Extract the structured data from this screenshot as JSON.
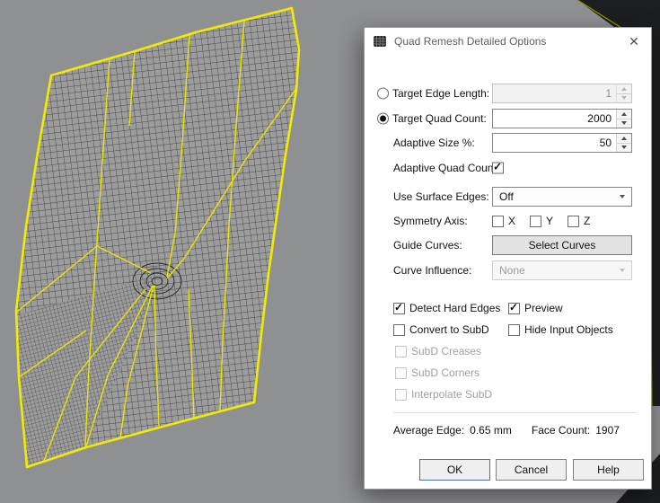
{
  "window": {
    "title": "Quad Remesh Detailed Options",
    "close_icon": "✕"
  },
  "options": {
    "target_edge_length": {
      "label": "Target Edge Length:",
      "value": "1",
      "enabled": false,
      "selected": false
    },
    "target_quad_count": {
      "label": "Target Quad Count:",
      "value": "2000",
      "enabled": true,
      "selected": true
    },
    "adaptive_size": {
      "label": "Adaptive Size %:",
      "value": "50"
    },
    "adaptive_quad_count": {
      "label": "Adaptive Quad Count:",
      "checked": true
    },
    "use_surface_edges": {
      "label": "Use Surface Edges:",
      "value": "Off"
    },
    "symmetry_axis": {
      "label": "Symmetry Axis:",
      "x": "X",
      "y": "Y",
      "z": "Z",
      "x_checked": false,
      "y_checked": false,
      "z_checked": false
    },
    "guide_curves": {
      "label": "Guide Curves:",
      "button_label": "Select Curves"
    },
    "curve_influence": {
      "label": "Curve Influence:",
      "value": "None",
      "enabled": false
    }
  },
  "toggles": {
    "detect_hard_edges": {
      "label": "Detect Hard Edges",
      "checked": true
    },
    "preview": {
      "label": "Preview",
      "checked": true
    },
    "convert_to_subd": {
      "label": "Convert to SubD",
      "checked": false
    },
    "hide_input_objects": {
      "label": "Hide Input Objects",
      "checked": false
    },
    "subd_creases": {
      "label": "SubD Creases",
      "checked": false,
      "enabled": false
    },
    "subd_corners": {
      "label": "SubD Corners",
      "checked": false,
      "enabled": false
    },
    "interpolate_subd": {
      "label": "Interpolate SubD",
      "checked": false,
      "enabled": false
    }
  },
  "status": {
    "average_edge_label": "Average Edge:",
    "average_edge_value": "0.65 mm",
    "face_count_label": "Face Count:",
    "face_count_value": "1907"
  },
  "buttons": {
    "ok": "OK",
    "cancel": "Cancel",
    "help": "Help"
  },
  "viewport": {
    "background": "#8f9092",
    "mesh_outline_color": "#f0eb00",
    "wire_color": "#2d2d2d"
  }
}
